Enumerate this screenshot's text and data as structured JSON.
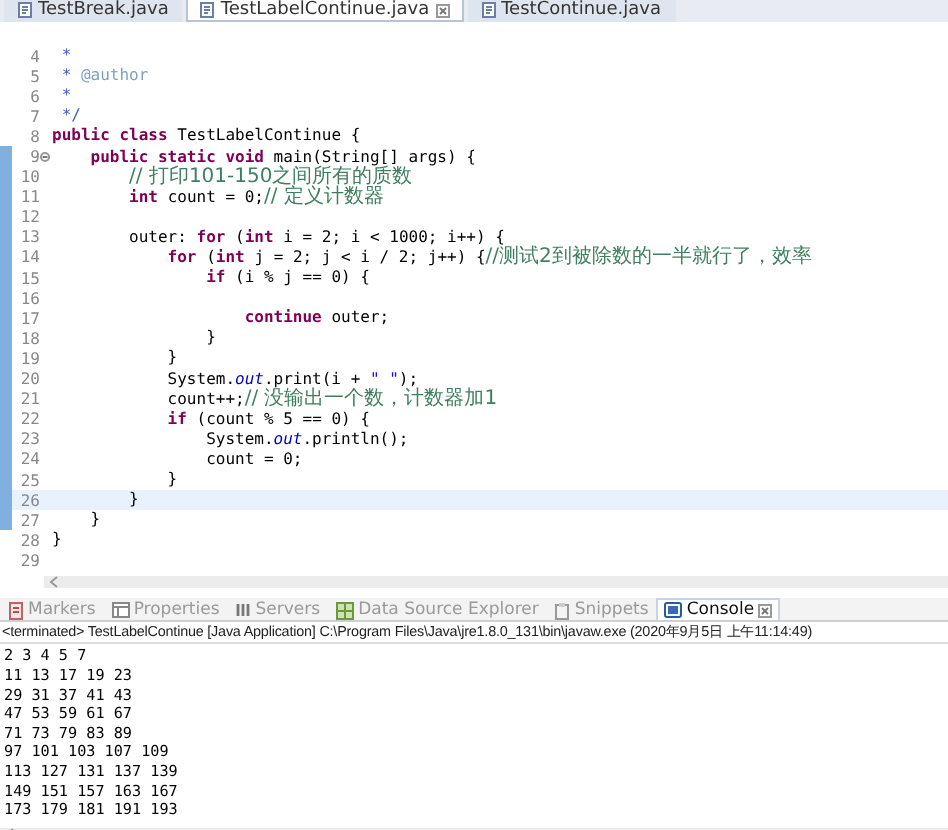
{
  "editor_tabs": [
    {
      "label": "TestBreak.java",
      "selected": false,
      "closable": false
    },
    {
      "label": "TestLabelContinue.java",
      "selected": true,
      "closable": true
    },
    {
      "label": "TestContinue.java",
      "selected": false,
      "closable": false
    }
  ],
  "editor": {
    "lines": [
      {
        "number": "4",
        "current": false,
        "marked": false,
        "fold": false,
        "tokens": [
          {
            "kind": "doc",
            "text": " *"
          }
        ]
      },
      {
        "number": "5",
        "current": false,
        "marked": false,
        "fold": false,
        "tokens": [
          {
            "kind": "doc",
            "text": " * "
          },
          {
            "kind": "doctag",
            "text": "@author"
          }
        ]
      },
      {
        "number": "6",
        "current": false,
        "marked": false,
        "fold": false,
        "tokens": [
          {
            "kind": "doc",
            "text": " *"
          }
        ]
      },
      {
        "number": "7",
        "current": false,
        "marked": false,
        "fold": false,
        "tokens": [
          {
            "kind": "doc",
            "text": " */"
          }
        ]
      },
      {
        "number": "8",
        "current": false,
        "marked": false,
        "fold": false,
        "tokens": [
          {
            "kind": "keyword",
            "text": "public class"
          },
          {
            "kind": "plain",
            "text": " TestLabelContinue {"
          }
        ]
      },
      {
        "number": "9",
        "current": false,
        "marked": true,
        "fold": true,
        "tokens": [
          {
            "kind": "keyword",
            "text": "    public static void"
          },
          {
            "kind": "plain",
            "text": " main(String[] args) {"
          }
        ]
      },
      {
        "number": "10",
        "current": false,
        "marked": true,
        "fold": false,
        "tokens": [
          {
            "kind": "comment",
            "text": "        // 打印101-150之间所有的质数"
          }
        ]
      },
      {
        "number": "11",
        "current": false,
        "marked": true,
        "fold": false,
        "tokens": [
          {
            "kind": "keyword",
            "text": "        int"
          },
          {
            "kind": "plain",
            "text": " count = 0;"
          },
          {
            "kind": "comment",
            "text": "// 定义计数器"
          }
        ]
      },
      {
        "number": "12",
        "current": false,
        "marked": true,
        "fold": false
      },
      {
        "number": "13",
        "current": false,
        "marked": true,
        "fold": false,
        "tokens": [
          {
            "kind": "plain",
            "text": "        outer: "
          },
          {
            "kind": "keyword",
            "text": "for"
          },
          {
            "kind": "plain",
            "text": " ("
          },
          {
            "kind": "keyword",
            "text": "int"
          },
          {
            "kind": "plain",
            "text": " i = 2; i < 1000; i++) {"
          }
        ]
      },
      {
        "number": "14",
        "current": false,
        "marked": true,
        "fold": false,
        "tokens": [
          {
            "kind": "keyword",
            "text": "            for"
          },
          {
            "kind": "plain",
            "text": " ("
          },
          {
            "kind": "keyword",
            "text": "int"
          },
          {
            "kind": "plain",
            "text": " j = 2; j < i / 2; j++) {"
          },
          {
            "kind": "comment",
            "text": "//测试2到被除数的一半就行了，效率"
          }
        ]
      },
      {
        "number": "15",
        "current": false,
        "marked": true,
        "fold": false,
        "tokens": [
          {
            "kind": "keyword",
            "text": "                if"
          },
          {
            "kind": "plain",
            "text": " (i % j == 0) {"
          }
        ]
      },
      {
        "number": "16",
        "current": false,
        "marked": true,
        "fold": false
      },
      {
        "number": "17",
        "current": false,
        "marked": true,
        "fold": false,
        "tokens": [
          {
            "kind": "keyword",
            "text": "                    continue"
          },
          {
            "kind": "plain",
            "text": " outer;"
          }
        ]
      },
      {
        "number": "18",
        "current": false,
        "marked": true,
        "fold": false,
        "tokens": [
          {
            "kind": "plain",
            "text": "                }"
          }
        ]
      },
      {
        "number": "19",
        "current": false,
        "marked": true,
        "fold": false,
        "tokens": [
          {
            "kind": "plain",
            "text": "            }"
          }
        ]
      },
      {
        "number": "20",
        "current": false,
        "marked": true,
        "fold": false,
        "tokens": [
          {
            "kind": "plain",
            "text": "            System."
          },
          {
            "kind": "field",
            "text": "out"
          },
          {
            "kind": "plain",
            "text": ".print(i + "
          },
          {
            "kind": "string",
            "text": "\" \""
          },
          {
            "kind": "plain",
            "text": ");"
          }
        ]
      },
      {
        "number": "21",
        "current": false,
        "marked": true,
        "fold": false,
        "tokens": [
          {
            "kind": "plain",
            "text": "            count++;"
          },
          {
            "kind": "comment",
            "text": "// 没输出一个数，计数器加1"
          }
        ]
      },
      {
        "number": "22",
        "current": false,
        "marked": true,
        "fold": false,
        "tokens": [
          {
            "kind": "keyword",
            "text": "            if"
          },
          {
            "kind": "plain",
            "text": " (count % 5 == 0) {"
          }
        ]
      },
      {
        "number": "23",
        "current": false,
        "marked": true,
        "fold": false,
        "tokens": [
          {
            "kind": "plain",
            "text": "                System."
          },
          {
            "kind": "field",
            "text": "out"
          },
          {
            "kind": "plain",
            "text": ".println();"
          }
        ]
      },
      {
        "number": "24",
        "current": false,
        "marked": true,
        "fold": false,
        "tokens": [
          {
            "kind": "plain",
            "text": "                count = 0;"
          }
        ]
      },
      {
        "number": "25",
        "current": false,
        "marked": true,
        "fold": false,
        "tokens": [
          {
            "kind": "plain",
            "text": "            }"
          }
        ]
      },
      {
        "number": "26",
        "current": true,
        "marked": true,
        "fold": false,
        "tokens": [
          {
            "kind": "plain",
            "text": "        }"
          }
        ]
      },
      {
        "number": "27",
        "current": false,
        "marked": true,
        "fold": false,
        "tokens": [
          {
            "kind": "plain",
            "text": "    }"
          }
        ]
      },
      {
        "number": "28",
        "current": false,
        "marked": false,
        "fold": false,
        "tokens": [
          {
            "kind": "plain",
            "text": "}"
          }
        ]
      },
      {
        "number": "29",
        "current": false,
        "marked": false,
        "fold": false
      }
    ]
  },
  "views": {
    "tabs": [
      {
        "label": "Markers",
        "kind": "markers",
        "selected": false,
        "closable": false
      },
      {
        "label": "Properties",
        "kind": "properties",
        "selected": false,
        "closable": false
      },
      {
        "label": "Servers",
        "kind": "servers",
        "selected": false,
        "closable": false
      },
      {
        "label": "Data Source Explorer",
        "kind": "datasource",
        "selected": false,
        "closable": false
      },
      {
        "label": "Snippets",
        "kind": "snippets",
        "selected": false,
        "closable": false
      },
      {
        "label": "Console",
        "kind": "console",
        "selected": true,
        "closable": true
      }
    ]
  },
  "console": {
    "status": "<terminated> TestLabelContinue [Java Application] C:\\Program Files\\Java\\jre1.8.0_131\\bin\\javaw.exe (2020年9月5日 上午11:14:49)",
    "output": [
      "2 3 4 5 7",
      "11 13 17 19 23",
      "29 31 37 41 43",
      "47 53 59 61 67",
      "71 73 79 83 89",
      "97 101 103 107 109",
      "113 127 131 137 139",
      "149 151 157 163 167",
      "173 179 181 191 193"
    ]
  }
}
